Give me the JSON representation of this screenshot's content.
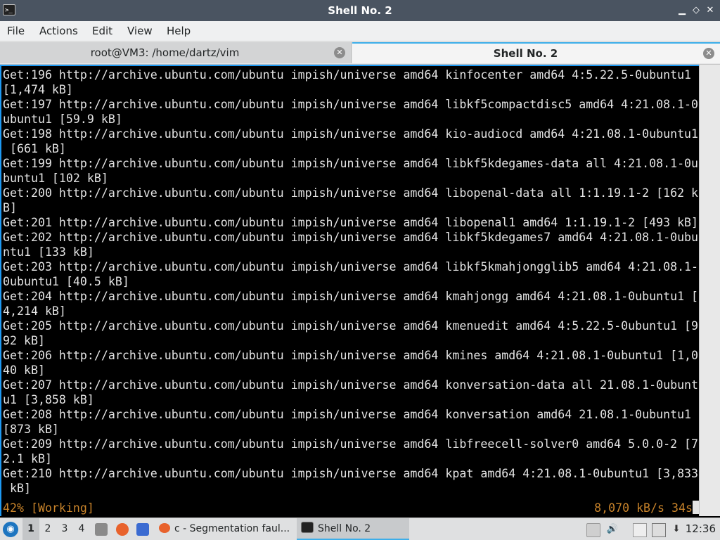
{
  "window": {
    "title": "Shell No. 2"
  },
  "menu": [
    "File",
    "Actions",
    "Edit",
    "View",
    "Help"
  ],
  "tabs": [
    {
      "label": "root@VM3: /home/dartz/vim",
      "active": false
    },
    {
      "label": "Shell No. 2",
      "active": true
    }
  ],
  "terminal": {
    "lines": [
      "Get:196 http://archive.ubuntu.com/ubuntu impish/universe amd64 kinfocenter amd64 4:5.22.5-0ubuntu1",
      "[1,474 kB]",
      "Get:197 http://archive.ubuntu.com/ubuntu impish/universe amd64 libkf5compactdisc5 amd64 4:21.08.1-0",
      "ubuntu1 [59.9 kB]",
      "Get:198 http://archive.ubuntu.com/ubuntu impish/universe amd64 kio-audiocd amd64 4:21.08.1-0ubuntu1",
      " [661 kB]",
      "Get:199 http://archive.ubuntu.com/ubuntu impish/universe amd64 libkf5kdegames-data all 4:21.08.1-0u",
      "buntu1 [102 kB]",
      "Get:200 http://archive.ubuntu.com/ubuntu impish/universe amd64 libopenal-data all 1:1.19.1-2 [162 k",
      "B]",
      "Get:201 http://archive.ubuntu.com/ubuntu impish/universe amd64 libopenal1 amd64 1:1.19.1-2 [493 kB]",
      "Get:202 http://archive.ubuntu.com/ubuntu impish/universe amd64 libkf5kdegames7 amd64 4:21.08.1-0ubu",
      "ntu1 [133 kB]",
      "Get:203 http://archive.ubuntu.com/ubuntu impish/universe amd64 libkf5kmahjongglib5 amd64 4:21.08.1-",
      "0ubuntu1 [40.5 kB]",
      "Get:204 http://archive.ubuntu.com/ubuntu impish/universe amd64 kmahjongg amd64 4:21.08.1-0ubuntu1 [",
      "4,214 kB]",
      "Get:205 http://archive.ubuntu.com/ubuntu impish/universe amd64 kmenuedit amd64 4:5.22.5-0ubuntu1 [9",
      "92 kB]",
      "Get:206 http://archive.ubuntu.com/ubuntu impish/universe amd64 kmines amd64 4:21.08.1-0ubuntu1 [1,0",
      "40 kB]",
      "Get:207 http://archive.ubuntu.com/ubuntu impish/universe amd64 konversation-data all 21.08.1-0ubunt",
      "u1 [3,858 kB]",
      "Get:208 http://archive.ubuntu.com/ubuntu impish/universe amd64 konversation amd64 21.08.1-0ubuntu1",
      "[873 kB]",
      "Get:209 http://archive.ubuntu.com/ubuntu impish/universe amd64 libfreecell-solver0 amd64 5.0.0-2 [7",
      "2.1 kB]",
      "Get:210 http://archive.ubuntu.com/ubuntu impish/universe amd64 kpat amd64 4:21.08.1-0ubuntu1 [3,833",
      " kB]"
    ],
    "status_left": "42% [Working]",
    "status_right": "8,070 kB/s 34s"
  },
  "taskbar": {
    "workspaces": [
      "1",
      "2",
      "3",
      "4"
    ],
    "tasks": [
      {
        "label": "c - Segmentation faul...",
        "icon": "firefox-icon"
      },
      {
        "label": "Shell No. 2",
        "icon": "terminal-icon"
      }
    ],
    "clock": "12:36"
  },
  "colors": {
    "titlebar": "#4a5461",
    "accent": "#1d99f3",
    "status_text": "#c8832a"
  }
}
